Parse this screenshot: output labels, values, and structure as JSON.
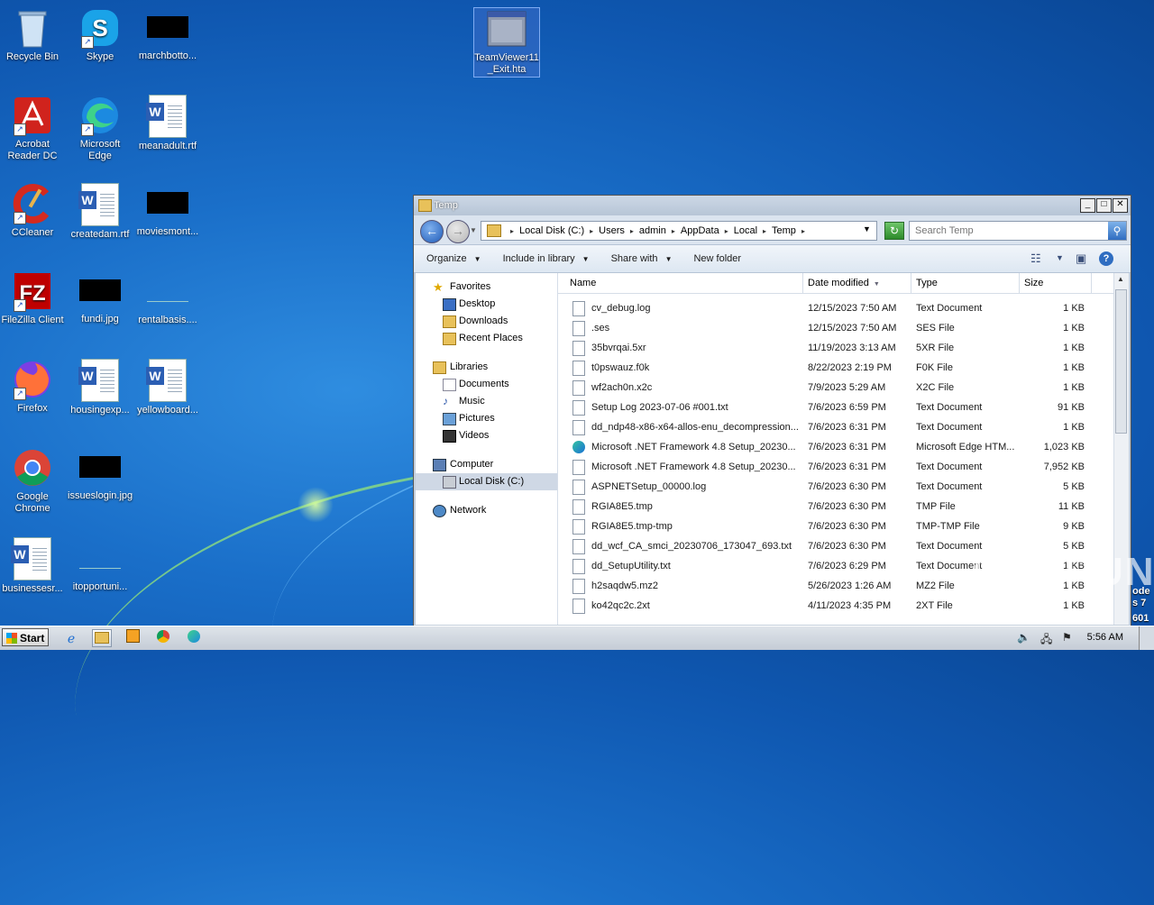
{
  "desktop": {
    "icons": [
      {
        "label": "Recycle Bin"
      },
      {
        "label": "Skype"
      },
      {
        "label": "marchbotto..."
      },
      {
        "label": "TeamViewer11\n_Exit.hta"
      },
      {
        "label": "Acrobat\nReader DC"
      },
      {
        "label": "Microsoft Edge"
      },
      {
        "label": "meanadult.rtf"
      },
      {
        "label": "CCleaner"
      },
      {
        "label": "createdam.rtf"
      },
      {
        "label": "moviesmont..."
      },
      {
        "label": "FileZilla Client"
      },
      {
        "label": "fundi.jpg"
      },
      {
        "label": "rentalbasis...."
      },
      {
        "label": "Firefox"
      },
      {
        "label": "housingexp..."
      },
      {
        "label": "yellowboard..."
      },
      {
        "label": "Google\nChrome"
      },
      {
        "label": "issueslogin.jpg"
      },
      {
        "label": "businessesr..."
      },
      {
        "label": "itopportuni..."
      }
    ],
    "side_text": [
      "ode",
      "s 7",
      "601"
    ],
    "watermark": "ANY.RUN"
  },
  "explorer": {
    "title": "Temp",
    "window_buttons": {
      "minimize": "_",
      "maximize": "□",
      "close": "✕"
    },
    "breadcrumbs": [
      "Local Disk (C:)",
      "Users",
      "admin",
      "AppData",
      "Local",
      "Temp"
    ],
    "search_placeholder": "Search Temp",
    "toolbar": {
      "organize": "Organize",
      "include": "Include in library",
      "share": "Share with",
      "new_folder": "New folder"
    },
    "nav": {
      "favorites": "Favorites",
      "desktop": "Desktop",
      "downloads": "Downloads",
      "recent": "Recent Places",
      "libraries": "Libraries",
      "documents": "Documents",
      "music": "Music",
      "pictures": "Pictures",
      "videos": "Videos",
      "computer": "Computer",
      "local_disk": "Local Disk (C:)",
      "network": "Network"
    },
    "columns": {
      "name": "Name",
      "date": "Date modified",
      "type": "Type",
      "size": "Size"
    },
    "files": [
      {
        "name": "cv_debug.log",
        "date": "12/15/2023 7:50 AM",
        "type": "Text Document",
        "size": "1 KB"
      },
      {
        "name": ".ses",
        "date": "12/15/2023 7:50 AM",
        "type": "SES File",
        "size": "1 KB"
      },
      {
        "name": "35bvrqai.5xr",
        "date": "11/19/2023 3:13 AM",
        "type": "5XR File",
        "size": "1 KB"
      },
      {
        "name": "t0pswauz.f0k",
        "date": "8/22/2023 2:19 PM",
        "type": "F0K File",
        "size": "1 KB"
      },
      {
        "name": "wf2ach0n.x2c",
        "date": "7/9/2023 5:29 AM",
        "type": "X2C File",
        "size": "1 KB"
      },
      {
        "name": "Setup Log 2023-07-06 #001.txt",
        "date": "7/6/2023 6:59 PM",
        "type": "Text Document",
        "size": "91 KB"
      },
      {
        "name": "dd_ndp48-x86-x64-allos-enu_decompression...",
        "date": "7/6/2023 6:31 PM",
        "type": "Text Document",
        "size": "1 KB"
      },
      {
        "name": "Microsoft .NET Framework 4.8 Setup_20230...",
        "date": "7/6/2023 6:31 PM",
        "type": "Microsoft Edge HTM...",
        "size": "1,023 KB"
      },
      {
        "name": "Microsoft .NET Framework 4.8 Setup_20230...",
        "date": "7/6/2023 6:31 PM",
        "type": "Text Document",
        "size": "7,952 KB"
      },
      {
        "name": "ASPNETSetup_00000.log",
        "date": "7/6/2023 6:30 PM",
        "type": "Text Document",
        "size": "5 KB"
      },
      {
        "name": "RGIA8E5.tmp",
        "date": "7/6/2023 6:30 PM",
        "type": "TMP File",
        "size": "11 KB"
      },
      {
        "name": "RGIA8E5.tmp-tmp",
        "date": "7/6/2023 6:30 PM",
        "type": "TMP-TMP File",
        "size": "9 KB"
      },
      {
        "name": "dd_wcf_CA_smci_20230706_173047_693.txt",
        "date": "7/6/2023 6:30 PM",
        "type": "Text Document",
        "size": "5 KB"
      },
      {
        "name": "dd_SetupUtility.txt",
        "date": "7/6/2023 6:29 PM",
        "type": "Text Document",
        "size": "1 KB"
      },
      {
        "name": "h2saqdw5.mz2",
        "date": "5/26/2023 1:26 AM",
        "type": "MZ2 File",
        "size": "1 KB"
      },
      {
        "name": "ko42qc2c.2xt",
        "date": "4/11/2023 4:35 PM",
        "type": "2XT File",
        "size": "1 KB"
      }
    ]
  },
  "taskbar": {
    "start": "Start",
    "clock": "5:56 AM"
  }
}
